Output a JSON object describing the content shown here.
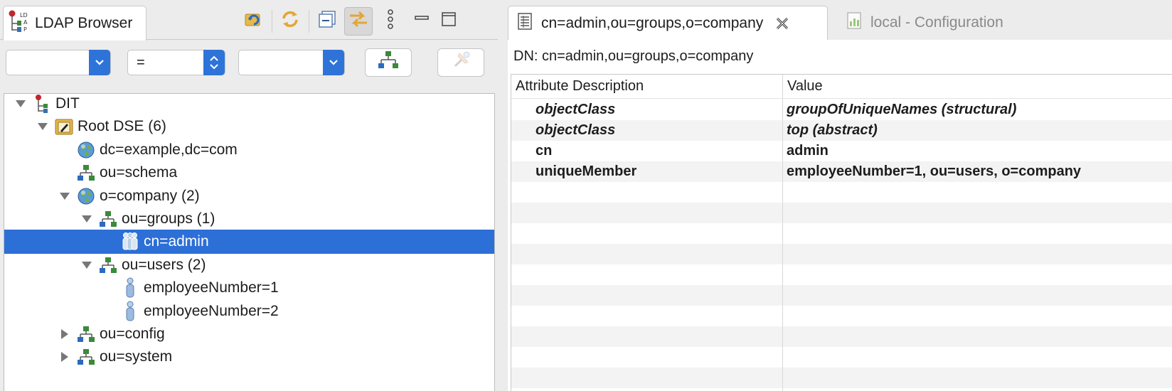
{
  "left_panel": {
    "tab_label": "LDAP Browser",
    "toolbar_icons": [
      "refresh-icon",
      "reload-icon",
      "collapse-all-icon",
      "link-with-editor-icon",
      "view-menu-icon",
      "minimize-icon",
      "maximize-icon"
    ],
    "filter": {
      "attribute_value": "",
      "operator_value": "=",
      "value_value": ""
    },
    "tree": [
      {
        "label": "DIT",
        "icon": "dit-icon",
        "level": 0,
        "twisty": "expanded"
      },
      {
        "label": "Root DSE (6)",
        "icon": "root-dse-icon",
        "level": 1,
        "twisty": "expanded"
      },
      {
        "label": "dc=example,dc=com",
        "icon": "globe-icon",
        "level": 2,
        "twisty": "none"
      },
      {
        "label": "ou=schema",
        "icon": "org-unit-icon",
        "level": 2,
        "twisty": "none"
      },
      {
        "label": "o=company (2)",
        "icon": "globe-icon",
        "level": 2,
        "twisty": "expanded"
      },
      {
        "label": "ou=groups (1)",
        "icon": "org-unit-icon",
        "level": 3,
        "twisty": "expanded"
      },
      {
        "label": "cn=admin",
        "icon": "group-icon",
        "level": 4,
        "twisty": "none",
        "selected": true
      },
      {
        "label": "ou=users (2)",
        "icon": "org-unit-icon",
        "level": 3,
        "twisty": "expanded"
      },
      {
        "label": "employeeNumber=1",
        "icon": "person-icon",
        "level": 4,
        "twisty": "none"
      },
      {
        "label": "employeeNumber=2",
        "icon": "person-icon",
        "level": 4,
        "twisty": "none"
      },
      {
        "label": "ou=config",
        "icon": "org-unit-icon",
        "level": 2,
        "twisty": "collapsed"
      },
      {
        "label": "ou=system",
        "icon": "org-unit-icon",
        "level": 2,
        "twisty": "collapsed"
      }
    ]
  },
  "editor": {
    "tabs": [
      {
        "label": "cn=admin,ou=groups,o=company",
        "active": true
      },
      {
        "label": "local - Configuration",
        "active": false
      }
    ],
    "dn_label": "DN: cn=admin,ou=groups,o=company",
    "table": {
      "headers": [
        "Attribute Description",
        "Value"
      ],
      "rows": [
        {
          "attribute": "objectClass",
          "value": "groupOfUniqueNames (structural)",
          "italic": true
        },
        {
          "attribute": "objectClass",
          "value": "top (abstract)",
          "italic": true
        },
        {
          "attribute": "cn",
          "value": "admin",
          "italic": false
        },
        {
          "attribute": "uniqueMember",
          "value": "employeeNumber=1, ou=users, o=company",
          "italic": false
        }
      ]
    }
  },
  "colors": {
    "selection": "#2c6fd6",
    "combo_arrow": "#2e74d8",
    "row_alt": "#f3f3f3"
  }
}
